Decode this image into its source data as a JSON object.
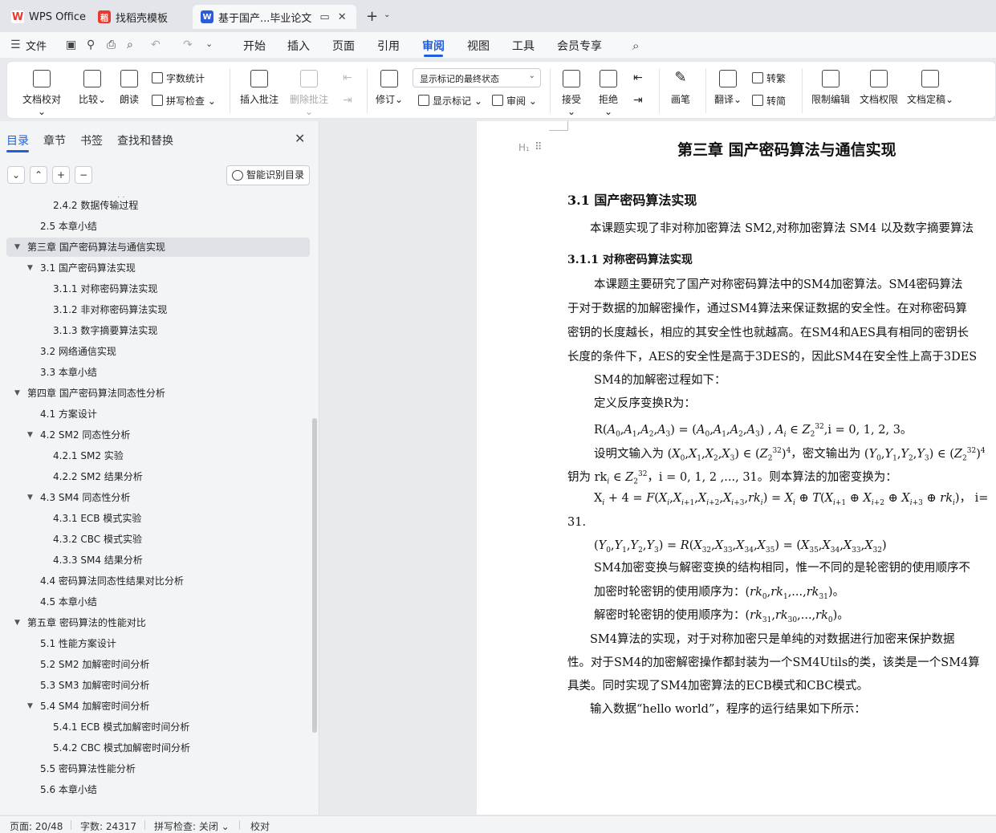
{
  "titlebar": {
    "tabs": [
      {
        "label": "WPS Office",
        "icon": "wps-logo-icon",
        "color": "#e63b2e"
      },
      {
        "label": "找稻壳模板",
        "icon": "docer-icon",
        "color": "#e63b2e"
      },
      {
        "label": "基于国产...毕业论文",
        "icon": "word-doc-icon",
        "color": "#2c5bd7",
        "active": true
      }
    ]
  },
  "menubar": {
    "file_label": "文件",
    "items": [
      "开始",
      "插入",
      "页面",
      "引用",
      "审阅",
      "视图",
      "工具",
      "会员专享"
    ],
    "active": "审阅"
  },
  "ribbon": {
    "doc_check": "文档校对",
    "compare": "比较",
    "read_aloud": "朗读",
    "word_count": "字数统计",
    "spell_check": "拼写检查",
    "insert_comment": "插入批注",
    "delete_comment": "删除批注",
    "revise": "修订",
    "markup_state": "显示标记的最终状态",
    "show_markup": "显示标记",
    "review_pane": "审阅",
    "accept": "接受",
    "reject": "拒绝",
    "pen": "画笔",
    "translate": "翻译",
    "to_traditional": "转繁",
    "to_simplified": "转简",
    "restrict_edit": "限制编辑",
    "doc_permission": "文档权限",
    "doc_finalize": "文档定稿"
  },
  "leftpanel": {
    "tabs": [
      "目录",
      "章节",
      "书签",
      "查找和替换"
    ],
    "active_tab": "目录",
    "smart_toc": "智能识别目录",
    "toc": [
      {
        "label": "2.4.2  数据传输过程",
        "level": 3
      },
      {
        "label": "2.5  本章小结",
        "level": 2
      },
      {
        "label": "第三章  国产密码算法与通信实现",
        "level": 1,
        "selected": true,
        "expanded": true
      },
      {
        "label": "3.1  国产密码算法实现",
        "level": 2,
        "expanded": true
      },
      {
        "label": "3.1.1  对称密码算法实现",
        "level": 3
      },
      {
        "label": "3.1.2  非对称密码算法实现",
        "level": 3
      },
      {
        "label": "3.1.3  数字摘要算法实现",
        "level": 3
      },
      {
        "label": "3.2  网络通信实现",
        "level": 2
      },
      {
        "label": "3.3  本章小结",
        "level": 2
      },
      {
        "label": "第四章  国产密码算法同态性分析",
        "level": 1,
        "expanded": true
      },
      {
        "label": "4.1  方案设计",
        "level": 2
      },
      {
        "label": "4.2 SM2 同态性分析",
        "level": 2,
        "expanded": true
      },
      {
        "label": "4.2.1 SM2 实验",
        "level": 3
      },
      {
        "label": "4.2.2 SM2 结果分析",
        "level": 3
      },
      {
        "label": "4.3 SM4 同态性分析",
        "level": 2,
        "expanded": true
      },
      {
        "label": "4.3.1 ECB 模式实验",
        "level": 3
      },
      {
        "label": "4.3.2 CBC 模式实验",
        "level": 3
      },
      {
        "label": "4.3.3 SM4 结果分析",
        "level": 3
      },
      {
        "label": "4.4  密码算法同态性结果对比分析",
        "level": 2
      },
      {
        "label": "4.5 本章小结",
        "level": 2
      },
      {
        "label": "第五章  密码算法的性能对比",
        "level": 1,
        "expanded": true
      },
      {
        "label": "5.1  性能方案设计",
        "level": 2
      },
      {
        "label": "5.2 SM2 加解密时间分析",
        "level": 2
      },
      {
        "label": "5.3 SM3 加解密时间分析",
        "level": 2
      },
      {
        "label": "5.4 SM4 加解密时间分析",
        "level": 2,
        "expanded": true
      },
      {
        "label": "5.4.1 ECB 模式加解密时间分析",
        "level": 3
      },
      {
        "label": "5.4.2 CBC 模式加解密时间分析",
        "level": 3
      },
      {
        "label": "5.5  密码算法性能分析",
        "level": 2
      },
      {
        "label": "5.6  本章小结",
        "level": 2
      }
    ]
  },
  "document": {
    "chapter_title": "第三章  国产密码算法与通信实现",
    "h2": "3.1  国产密码算法实现",
    "intro": "本课题实现了非对称加密算法 SM2,对称加密算法 SM4 以及数字摘要算法",
    "h3": "3.1.1  对称密码算法实现",
    "p1_l1": "本课题主要研究了国产对称密码算法中的SM4加密算法。SM4密码算法",
    "p1_l2": "于对于数据的加解密操作，通过SM4算法来保证数据的安全性。在对称密码算",
    "p1_l3": "密钥的长度越长，相应的其安全性也就越高。在SM4和AES具有相同的密钥长",
    "p1_l4": "长度的条件下，AES的安全性是高于3DES的，因此SM4在安全性上高于3DES",
    "p2": "SM4的加解密过程如下：",
    "p3": "定义反序变换R为：",
    "p4_tail": "i = 0, 1, 2, 3。",
    "p5_a": "设明文输入为",
    "p5_b": "，密文输出为",
    "p6_a": "钥为 rk",
    "p6_b": "，i = 0, 1, 2 ,..., 31。则本算法的加密变换为：",
    "p7_tail": "，  i=",
    "p8": "31.",
    "p10": "SM4加密变换与解密变换的结构相同，惟一不同的是轮密钥的使用顺序不",
    "p11": "加密时轮密钥的使用顺序为：",
    "p12": "解密时轮密钥的使用顺序为：",
    "p13_l1": "SM4算法的实现，对于对称加密只是单纯的对数据进行加密来保护数据",
    "p13_l2": "性。对于SM4的加密解密操作都封装为一个SM4Utils的类，该类是一个SM4算",
    "p13_l3": "具类。同时实现了SM4加密算法的ECB模式和CBC模式。",
    "p14": "输入数据“hello world”，程序的运行结果如下所示："
  },
  "statusbar": {
    "page": "页面: 20/48",
    "words": "字数: 24317",
    "spell": "拼写检查: 关闭",
    "proof": "校对"
  }
}
